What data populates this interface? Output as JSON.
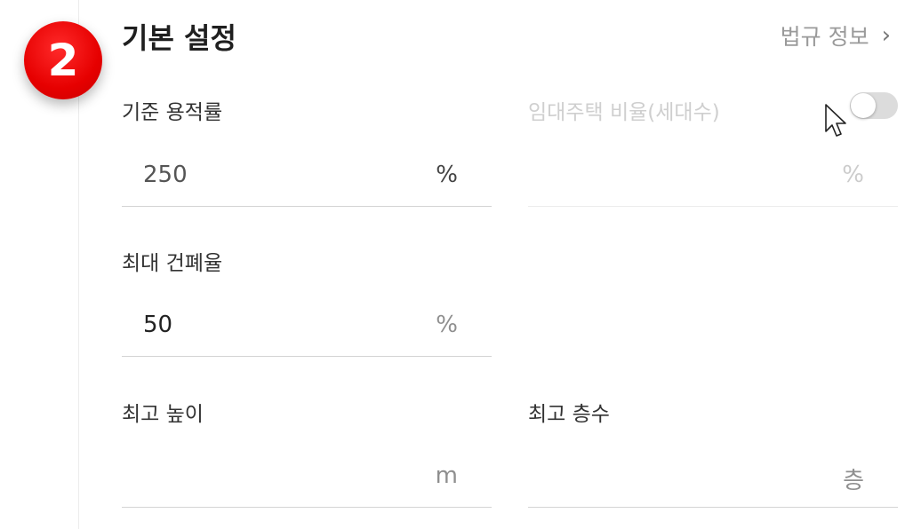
{
  "step": "2",
  "section": {
    "title": "기본 설정",
    "link_label": "법규 정보"
  },
  "fields": {
    "far": {
      "label": "기준 용적률",
      "value": "250",
      "unit": "%"
    },
    "rental": {
      "label": "임대주택 비율(세대수)",
      "value": "",
      "unit": "%",
      "toggle_on": false
    },
    "bcr": {
      "label": "최대 건폐율",
      "value": "50",
      "unit": "%"
    },
    "height": {
      "label": "최고 높이",
      "value": "",
      "unit": "m"
    },
    "floors": {
      "label": "최고 층수",
      "value": "",
      "unit": "층"
    }
  },
  "colors": {
    "badge": "#e60000",
    "toggle_off": "#dcdcdc"
  }
}
